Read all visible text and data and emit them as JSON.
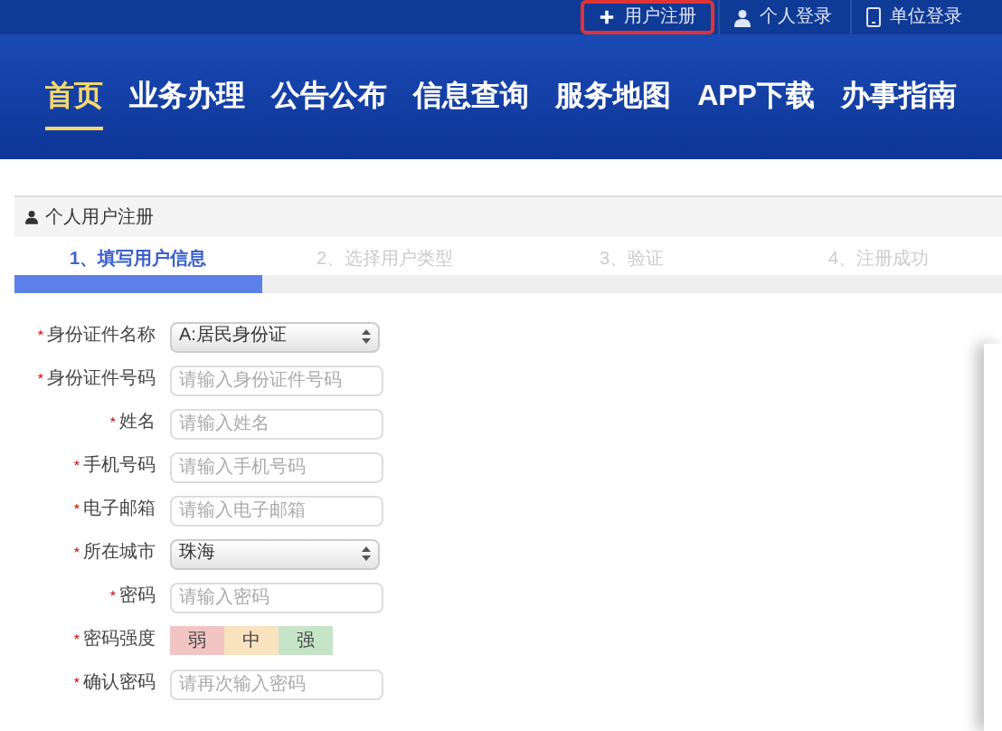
{
  "top_links": [
    {
      "label": "用户注册",
      "highlighted": true
    },
    {
      "label": "个人登录",
      "highlighted": false
    },
    {
      "label": "单位登录",
      "highlighted": false
    }
  ],
  "nav": [
    {
      "label": "首页",
      "selected": true
    },
    {
      "label": "业务办理",
      "selected": false
    },
    {
      "label": "公告公布",
      "selected": false
    },
    {
      "label": "信息查询",
      "selected": false
    },
    {
      "label": "服务地图",
      "selected": false
    },
    {
      "label": "APP下载",
      "selected": false
    },
    {
      "label": "办事指南",
      "selected": false
    }
  ],
  "section_title": "个人用户注册",
  "required_mark": "*",
  "steps": [
    {
      "label": "1、填写用户信息",
      "selected": true
    },
    {
      "label": "2、选择用户类型",
      "selected": false
    },
    {
      "label": "3、验证",
      "selected": false
    },
    {
      "label": "4、注册成功",
      "selected": false
    }
  ],
  "progress": {
    "level": 0.25
  },
  "form": [
    {
      "kind": "select",
      "required": true,
      "label": "身份证件名称",
      "value": "A:居民身份证"
    },
    {
      "kind": "input",
      "required": true,
      "label": "身份证件号码",
      "placeholder": "请输入身份证件号码"
    },
    {
      "kind": "input",
      "required": true,
      "label": "姓名",
      "placeholder": "请输入姓名"
    },
    {
      "kind": "input",
      "required": true,
      "label": "手机号码",
      "placeholder": "请输入手机号码"
    },
    {
      "kind": "input",
      "required": true,
      "label": "电子邮箱",
      "placeholder": "请输入电子邮箱"
    },
    {
      "kind": "select",
      "required": true,
      "label": "所在城市",
      "value": "珠海"
    },
    {
      "kind": "input",
      "required": true,
      "label": "密码",
      "placeholder": "请输入密码"
    },
    {
      "kind": "strength",
      "required": true,
      "label": "密码强度",
      "levels": [
        {
          "label": "弱",
          "color": "#f2c4c4"
        },
        {
          "label": "中",
          "color": "#f8e2c0"
        },
        {
          "label": "强",
          "color": "#c6e4c8"
        }
      ]
    },
    {
      "kind": "input",
      "required": true,
      "label": "确认密码",
      "placeholder": "请再次输入密码"
    }
  ]
}
